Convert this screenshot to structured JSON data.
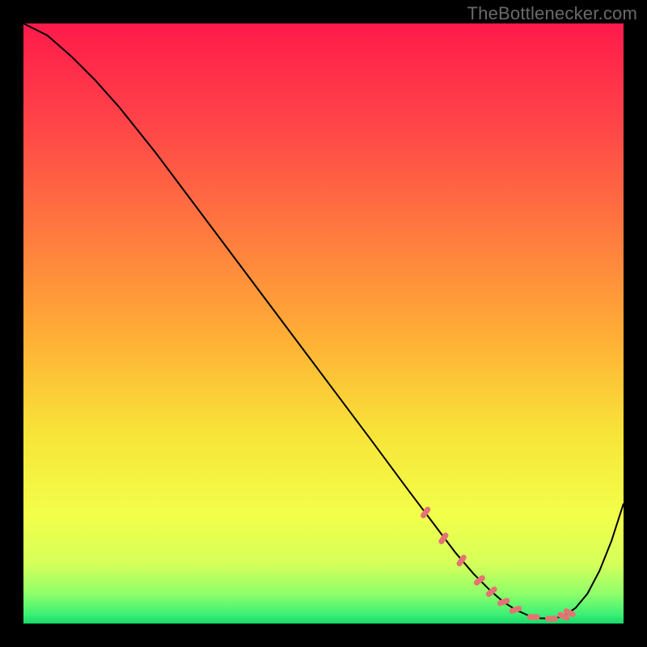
{
  "watermark": "TheBottlenecker.com",
  "chart_data": {
    "type": "line",
    "title": "",
    "xlabel": "",
    "ylabel": "",
    "xlim": [
      0,
      100
    ],
    "ylim": [
      0,
      100
    ],
    "grid": false,
    "legend": false,
    "gradient_stops": [
      {
        "offset": 0.0,
        "color": "#ff1a4b"
      },
      {
        "offset": 0.18,
        "color": "#ff4848"
      },
      {
        "offset": 0.35,
        "color": "#ff7a3f"
      },
      {
        "offset": 0.52,
        "color": "#ffae36"
      },
      {
        "offset": 0.68,
        "color": "#f8e338"
      },
      {
        "offset": 0.82,
        "color": "#f2ff4a"
      },
      {
        "offset": 0.9,
        "color": "#d6ff5a"
      },
      {
        "offset": 0.95,
        "color": "#8fff6a"
      },
      {
        "offset": 0.985,
        "color": "#3cf075"
      },
      {
        "offset": 1.0,
        "color": "#17d96a"
      }
    ],
    "series": [
      {
        "name": "curve",
        "type": "line",
        "color": "#000000",
        "x": [
          0,
          4,
          8,
          12,
          16,
          22,
          28,
          34,
          40,
          46,
          52,
          58,
          64,
          68,
          72,
          75,
          78,
          80,
          82,
          84,
          86,
          88,
          90,
          92,
          94,
          96,
          98,
          100
        ],
        "y": [
          100,
          98,
          94.5,
          90.5,
          86,
          78.5,
          70.5,
          62.5,
          54.5,
          46.5,
          38.5,
          30.5,
          22.4,
          17.1,
          11.8,
          8.3,
          5.3,
          3.6,
          2.3,
          1.4,
          0.9,
          0.8,
          1.2,
          2.6,
          5.0,
          8.8,
          13.8,
          20.0
        ]
      },
      {
        "name": "markers",
        "type": "scatter",
        "color": "#e57373",
        "x": [
          67,
          70,
          73,
          76,
          78,
          80,
          82,
          85,
          88,
          90,
          91
        ],
        "y": [
          18.5,
          14.2,
          10.5,
          7.2,
          5.3,
          3.6,
          2.3,
          1.1,
          0.8,
          1.2,
          1.8
        ]
      }
    ]
  }
}
